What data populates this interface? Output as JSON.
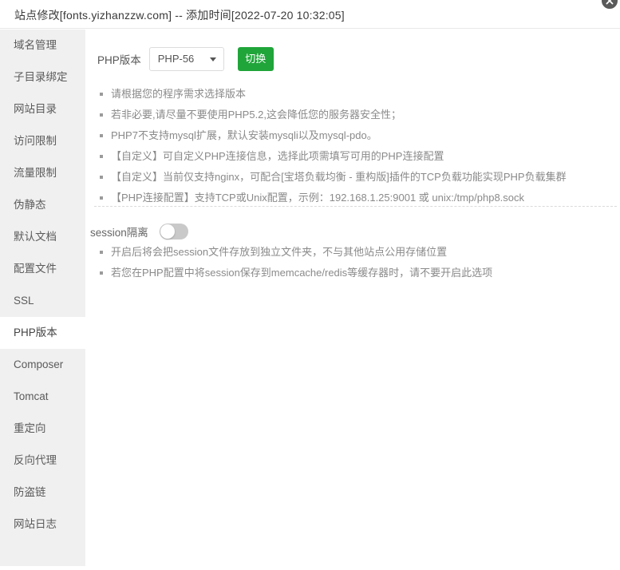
{
  "dialog": {
    "title": "站点修改[fonts.yizhanzzw.com] -- 添加时间[2022-07-20 10:32:05]",
    "close_icon": "close-icon"
  },
  "sidebar": {
    "items": [
      {
        "label": "域名管理",
        "active": false
      },
      {
        "label": "子目录绑定",
        "active": false
      },
      {
        "label": "网站目录",
        "active": false
      },
      {
        "label": "访问限制",
        "active": false
      },
      {
        "label": "流量限制",
        "active": false
      },
      {
        "label": "伪静态",
        "active": false
      },
      {
        "label": "默认文档",
        "active": false
      },
      {
        "label": "配置文件",
        "active": false
      },
      {
        "label": "SSL",
        "active": false
      },
      {
        "label": "PHP版本",
        "active": true
      },
      {
        "label": "Composer",
        "active": false
      },
      {
        "label": "Tomcat",
        "active": false
      },
      {
        "label": "重定向",
        "active": false
      },
      {
        "label": "反向代理",
        "active": false
      },
      {
        "label": "防盗链",
        "active": false
      },
      {
        "label": "网站日志",
        "active": false
      }
    ]
  },
  "php_version": {
    "label": "PHP版本",
    "selected": "PHP-56",
    "caret_icon": "chevron-down-icon",
    "switch_label": "切换",
    "switch_color": "#20a53a",
    "tips": [
      "请根据您的程序需求选择版本",
      "若非必要,请尽量不要使用PHP5.2,这会降低您的服务器安全性；",
      "PHP7不支持mysql扩展，默认安装mysqli以及mysql-pdo。",
      "【自定义】可自定义PHP连接信息，选择此项需填写可用的PHP连接配置",
      "【自定义】当前仅支持nginx，可配合[宝塔负载均衡 - 重构版]插件的TCP负载功能实现PHP负载集群",
      "【PHP连接配置】支持TCP或Unix配置，示例：192.168.1.25:9001 或 unix:/tmp/php8.sock"
    ]
  },
  "session_isolation": {
    "label": "session隔离",
    "enabled": false,
    "tips": [
      "开启后将会把session文件存放到独立文件夹，不与其他站点公用存储位置",
      "若您在PHP配置中将session保存到memcache/redis等缓存器时，请不要开启此选项"
    ]
  }
}
